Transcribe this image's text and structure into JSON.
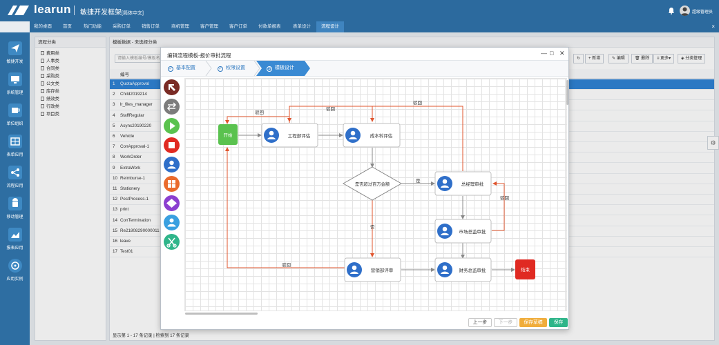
{
  "app": {
    "logo": "learun",
    "subtitle": "敏捷开发框架",
    "lang": "[简体中文]",
    "user": "超级管理员",
    "close_tab": "×"
  },
  "nav_tabs": [
    "我的桌面",
    "首页",
    "热门功能",
    "采购订单",
    "销售订单",
    "商机管理",
    "客户管理",
    "客户订单",
    "付款单报表",
    "表单设计",
    "流程设计"
  ],
  "left_nav": [
    "敏捷开发",
    "系统管理",
    "单位组织",
    "表单应用",
    "流程应用",
    "移动管理",
    "报表应用",
    "应用实例"
  ],
  "tree": {
    "title": "流程分类",
    "items": [
      "费用类",
      "人事类",
      "合同类",
      "采购类",
      "公文类",
      "库存类",
      "绩效类",
      "行政类",
      "项目类"
    ]
  },
  "list": {
    "title": "模板数据 - 未选择分类",
    "search_placeholder": "请输入模板编号/模板名称",
    "toolbar": {
      "refresh": "↻",
      "add": "新增",
      "edit": "编辑",
      "delete": "删除",
      "more": "更多▾",
      "category": "分类管理"
    },
    "col_code": "编号",
    "rows": [
      {
        "n": "1",
        "code": "QuotaApproval"
      },
      {
        "n": "2",
        "code": "Child2019214"
      },
      {
        "n": "3",
        "code": "lr_files_manager"
      },
      {
        "n": "4",
        "code": "StaffRegular"
      },
      {
        "n": "5",
        "code": "Async20190220"
      },
      {
        "n": "6",
        "code": "Vehicle"
      },
      {
        "n": "7",
        "code": "ConApproval-1"
      },
      {
        "n": "8",
        "code": "WorkOrder"
      },
      {
        "n": "9",
        "code": "ExtraWork"
      },
      {
        "n": "10",
        "code": "Reimburse-1"
      },
      {
        "n": "11",
        "code": "Stationery"
      },
      {
        "n": "12",
        "code": "PostProcess-1"
      },
      {
        "n": "13",
        "code": "print"
      },
      {
        "n": "14",
        "code": "ConTermination"
      },
      {
        "n": "15",
        "code": "Re21808290000011"
      },
      {
        "n": "16",
        "code": "leave"
      },
      {
        "n": "17",
        "code": "Test01"
      }
    ],
    "status": "显示第 1 - 17 条记录 | 检索到 17 条记录"
  },
  "modal": {
    "title": "编辑流程模板-报价审批流程",
    "controls": {
      "minimize": "—",
      "maximize": "□",
      "close": "✕"
    },
    "steps": [
      {
        "num": "✓",
        "label": "基本配置"
      },
      {
        "num": "✓",
        "label": "权限设置"
      },
      {
        "num": "3",
        "label": "模板设计"
      }
    ],
    "buttons": {
      "prev": "上一步",
      "next": "下一步",
      "save_draft": "保存草稿",
      "save": "保存"
    }
  },
  "flow": {
    "nodes": {
      "start": "开始",
      "eng": "工程部评估",
      "cost": "成本科评估",
      "decision": "是否超过百万金额",
      "gm": "总经理审批",
      "market": "市场总监审批",
      "sales": "营销部评审",
      "finance": "财务总监审批",
      "end": "结束"
    },
    "labels": {
      "reject": "驳回",
      "yes": "是",
      "no": "否"
    }
  },
  "colors": {
    "brand": "#2c6a9e",
    "selected_row": "#2f83d4",
    "start": "#5ac24f",
    "end": "#e02a22",
    "reject_line": "#e0552e",
    "save_draft": "#f0ad3c",
    "save": "#2fb58a"
  }
}
